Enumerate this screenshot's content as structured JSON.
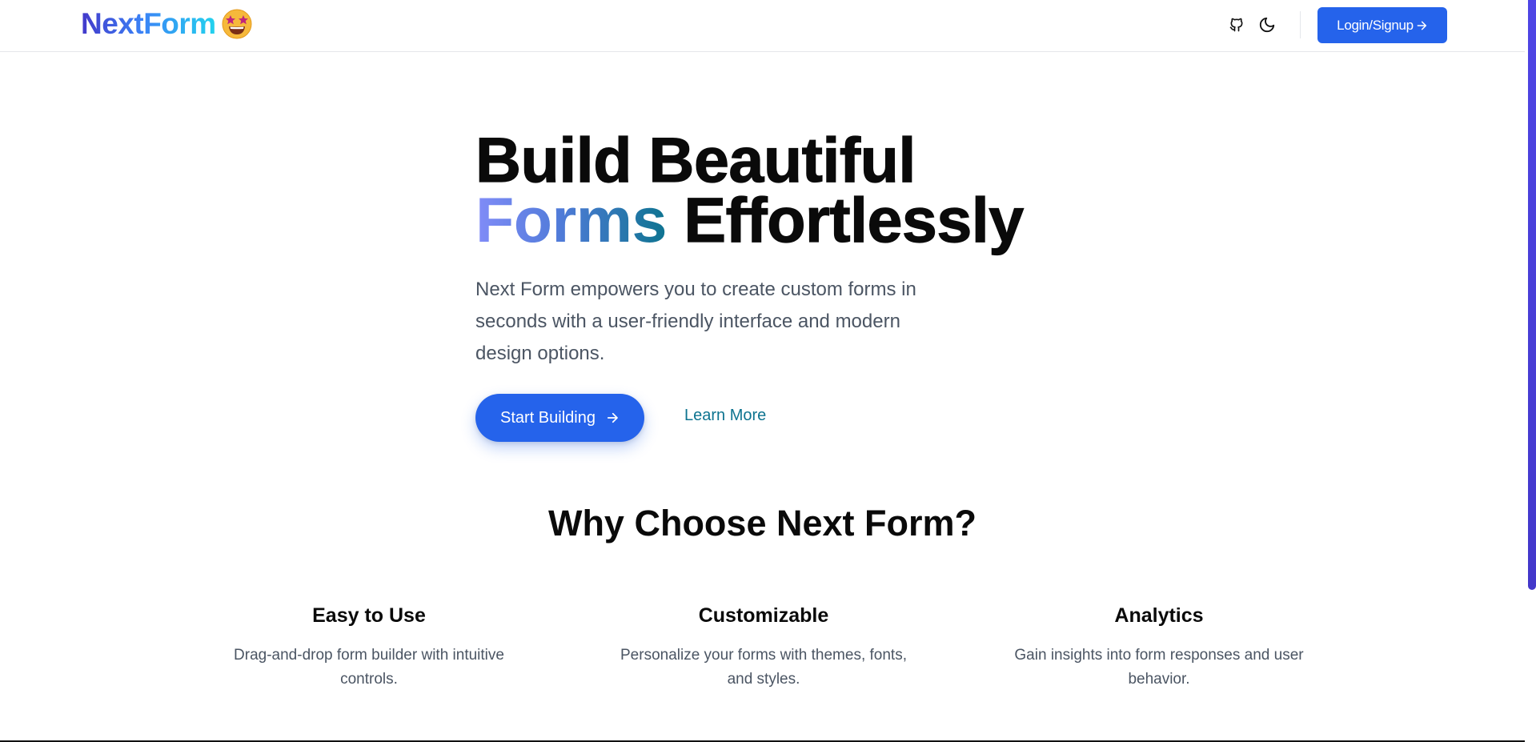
{
  "header": {
    "logo_text": "NextForm",
    "logo_emoji": "star-struck-emoji",
    "github_icon": "github-icon",
    "theme_icon": "moon-icon",
    "login_label": "Login/Signup",
    "login_icon": "arrow-right-icon"
  },
  "hero": {
    "title_line1": "Build Beautiful",
    "title_highlight": "Forms",
    "title_line2_rest": " Effortlessly",
    "subtitle": "Next Form empowers you to create custom forms in seconds with a user-friendly interface and modern design options.",
    "start_label": "Start Building",
    "learn_label": "Learn More"
  },
  "why": {
    "title": "Why Choose Next Form?",
    "features": [
      {
        "title": "Easy to Use",
        "description": "Drag-and-drop form builder with intuitive controls."
      },
      {
        "title": "Customizable",
        "description": "Personalize your forms with themes, fonts, and styles."
      },
      {
        "title": "Analytics",
        "description": "Gain insights into form responses and user behavior."
      }
    ]
  },
  "colors": {
    "primary": "#2563eb",
    "accent_teal": "#0e7490",
    "muted_text": "#4b5563",
    "scroll_accent": "#4f46e5"
  }
}
